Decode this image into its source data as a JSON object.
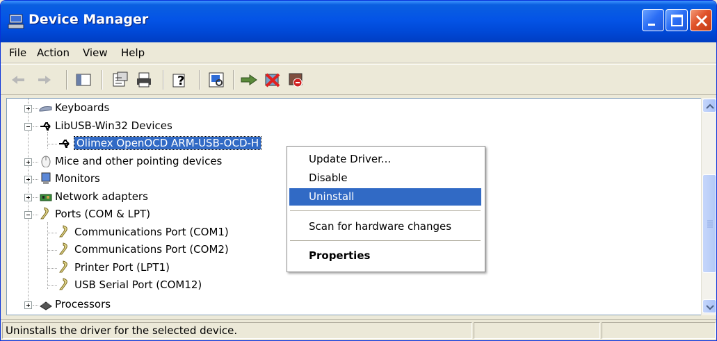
{
  "window": {
    "title": "Device Manager"
  },
  "menu": [
    "File",
    "Action",
    "View",
    "Help"
  ],
  "tree": {
    "keyboards": "Keyboards",
    "libusb": "LibUSB-Win32 Devices",
    "olimex": "Olimex OpenOCD ARM-USB-OCD-H",
    "mice": "Mice and other pointing devices",
    "monitors": "Monitors",
    "network": "Network adapters",
    "ports": "Ports (COM & LPT)",
    "com1": "Communications Port (COM1)",
    "com2": "Communications Port (COM2)",
    "lpt1": "Printer Port (LPT1)",
    "com12": "USB Serial Port (COM12)",
    "processors": "Processors"
  },
  "context_menu": {
    "update": "Update Driver...",
    "disable": "Disable",
    "uninstall": "Uninstall",
    "scan": "Scan for hardware changes",
    "properties": "Properties"
  },
  "status": {
    "text": "Uninstalls the driver for the selected device."
  },
  "icons": {
    "title": "device-manager-icon",
    "back": "back-arrow-icon",
    "forward": "forward-arrow-icon",
    "show_hide": "show-hide-console-tree-icon",
    "properties": "properties-icon",
    "print": "printer-icon",
    "help": "help-icon",
    "scan": "scan-hardware-icon",
    "update": "update-driver-icon",
    "uninstall": "uninstall-icon",
    "disable": "disable-icon"
  },
  "colors": {
    "selection": "#316ac5",
    "titlebar": "#0454e6",
    "close": "#e0522a"
  }
}
